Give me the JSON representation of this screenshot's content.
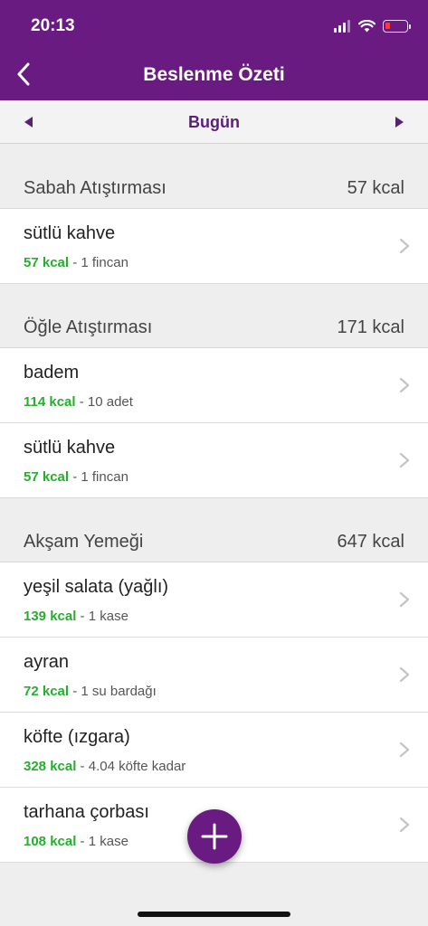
{
  "status_bar": {
    "time": "20:13"
  },
  "header": {
    "title": "Beslenme Özeti"
  },
  "date_nav": {
    "label": "Bugün"
  },
  "colors": {
    "brand": "#6a1b82",
    "kcal": "#23b02a",
    "date_label": "#5b1f7a"
  },
  "sections": [
    {
      "title": "Sabah Atıştırması",
      "total": "57 kcal",
      "items": [
        {
          "name": "sütlü kahve",
          "kcal": "57 kcal",
          "portion": " - 1 fincan"
        }
      ]
    },
    {
      "title": "Öğle Atıştırması",
      "total": "171 kcal",
      "items": [
        {
          "name": "badem",
          "kcal": "114 kcal",
          "portion": " - 10 adet"
        },
        {
          "name": "sütlü kahve",
          "kcal": "57 kcal",
          "portion": " - 1 fincan"
        }
      ]
    },
    {
      "title": "Akşam Yemeği",
      "total": "647 kcal",
      "items": [
        {
          "name": "yeşil salata (yağlı)",
          "kcal": "139 kcal",
          "portion": " - 1 kase"
        },
        {
          "name": "ayran",
          "kcal": "72 kcal",
          "portion": " - 1 su bardağı"
        },
        {
          "name": "köfte (ızgara)",
          "kcal": "328 kcal",
          "portion": " - 4.04 köfte kadar"
        },
        {
          "name": "tarhana çorbası",
          "kcal": "108 kcal",
          "portion": " - 1 kase"
        }
      ]
    }
  ],
  "icons": {
    "back": "chevron-left-icon",
    "prev": "triangle-left-icon",
    "next": "triangle-right-icon",
    "row": "chevron-right-icon",
    "fab": "plus-icon"
  }
}
